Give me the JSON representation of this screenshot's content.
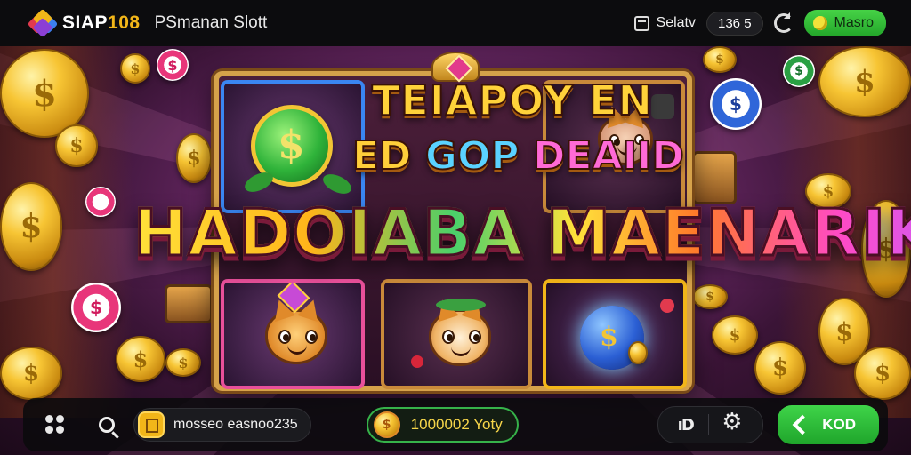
{
  "header": {
    "brand_prefix": "SIAP",
    "brand_number": "108",
    "subtitle": "PSmanan Slott",
    "selector_label": "Selatv",
    "count_badge": "136 5",
    "account_button": "Masro",
    "logo_icon": "diamond-logo-icon",
    "refresh_icon": "refresh-icon"
  },
  "banner": {
    "line1": "TEIAPOY EN",
    "line2_a": "ED ",
    "line2_b": "GOP",
    "line2_c": " DEAIID",
    "line3": "HADOIABA MAENARIK"
  },
  "coin_symbol": "$",
  "reels": [
    {
      "symbol": "green-coin-icon"
    },
    {
      "symbol": "wolf-mascot-icon"
    },
    {
      "symbol": "lion-mascot-icon"
    },
    {
      "symbol": "tiger-mascot-icon"
    },
    {
      "symbol": "blue-orb-icon"
    }
  ],
  "footer": {
    "menu_icon": "grid-menu-icon",
    "search_icon": "search-icon",
    "account_text": "mosseo easnoo235",
    "balance_text": "1000002 Yoty",
    "sound_label": "ıD",
    "settings_icon": "gear-icon",
    "play_label": "KOD"
  },
  "colors": {
    "accent_gold": "#f2b619",
    "accent_green": "#2fb83c",
    "topbar_bg": "#0c0c0e"
  }
}
